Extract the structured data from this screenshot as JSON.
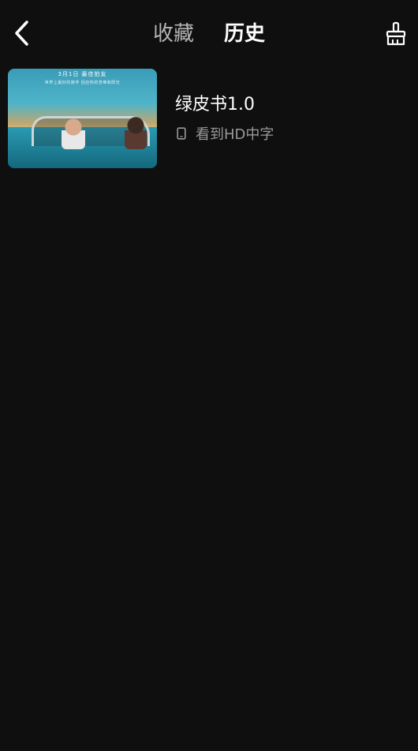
{
  "header": {
    "back_icon": "chevron-left-icon",
    "tabs": [
      {
        "label": "收藏",
        "active": false
      },
      {
        "label": "历史",
        "active": true
      }
    ],
    "clear_icon": "brush-clean-icon"
  },
  "history": {
    "items": [
      {
        "title": "绿皮书1.0",
        "progress_text": "看到HD中字",
        "device_icon": "phone-icon",
        "poster": {
          "top_text": "3月1日  最佳拍友",
          "sub_text": "世界上最好的旅伴 回应你的苦难和阳光"
        }
      }
    ]
  },
  "colors": {
    "background": "#0f0f0f",
    "active_text": "#ffffff",
    "inactive_text": "#b5b5b5",
    "meta_text": "#9a9a9a"
  }
}
